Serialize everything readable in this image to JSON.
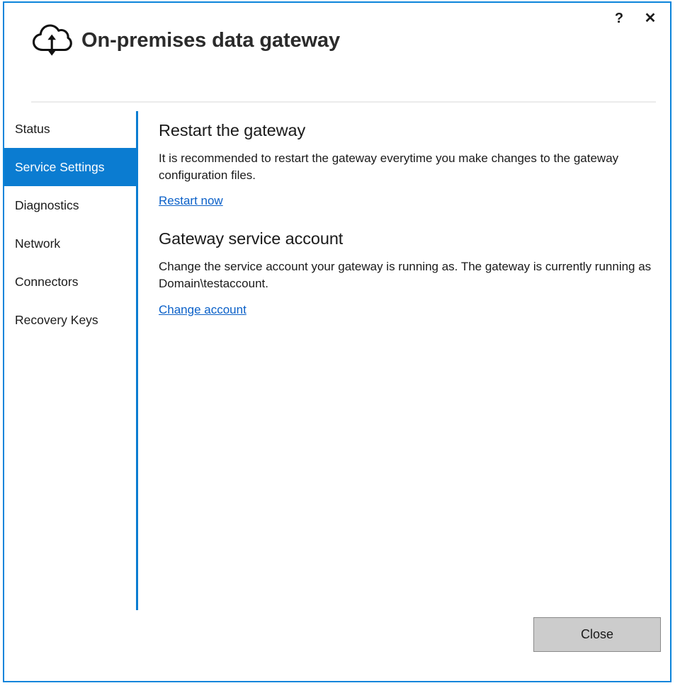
{
  "window": {
    "title": "On-premises data gateway",
    "icon": "cloud-updown-arrow-icon",
    "accent_color": "#0b7cd1",
    "border_color": "#0b84da",
    "help_button": "?",
    "close_button": "✕"
  },
  "sidebar": {
    "items": [
      {
        "label": "Status",
        "selected": false
      },
      {
        "label": "Service Settings",
        "selected": true
      },
      {
        "label": "Diagnostics",
        "selected": false
      },
      {
        "label": "Network",
        "selected": false
      },
      {
        "label": "Connectors",
        "selected": false
      },
      {
        "label": "Recovery Keys",
        "selected": false
      }
    ]
  },
  "main": {
    "sections": [
      {
        "heading": "Restart the gateway",
        "body": "It is recommended to restart the gateway everytime you make changes to the gateway configuration files.",
        "link": "Restart now"
      },
      {
        "heading": "Gateway service account",
        "body": "Change the service account your gateway is running as. The gateway is currently running as Domain\\testaccount.",
        "link": "Change account"
      }
    ]
  },
  "footer": {
    "close_label": "Close"
  }
}
